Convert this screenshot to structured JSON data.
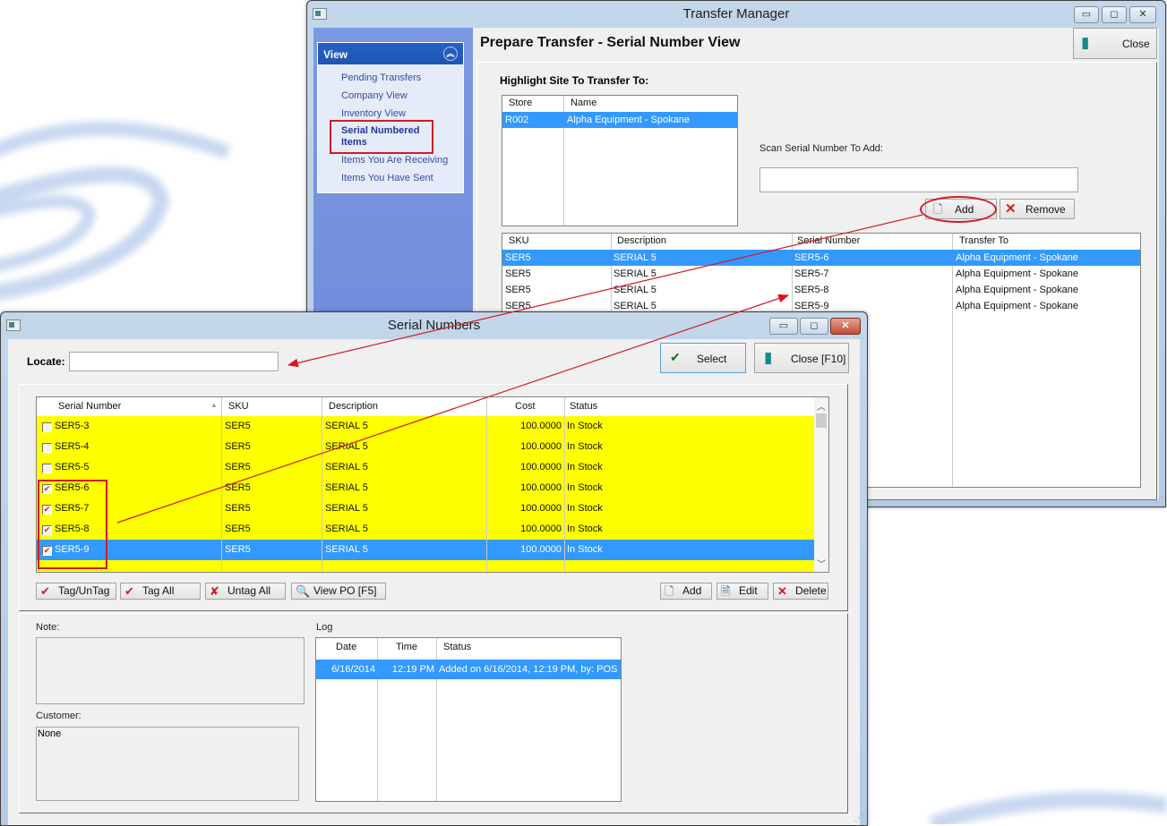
{
  "transfer_manager": {
    "title": "Transfer Manager",
    "page_title": "Prepare Transfer - Serial Number View",
    "close_label": "Close",
    "nav": {
      "header": "View",
      "items": [
        {
          "label": "Pending Transfers"
        },
        {
          "label": "Company View"
        },
        {
          "label": "Inventory View"
        },
        {
          "label": "Serial Numbered Items",
          "active": true
        },
        {
          "label": "Items You Are Receiving"
        },
        {
          "label": "Items You Have Sent"
        }
      ]
    },
    "site_label": "Highlight Site To Transfer To:",
    "sites": {
      "columns": [
        "Store",
        "Name"
      ],
      "rows": [
        [
          "R002",
          "Alpha Equipment - Spokane"
        ]
      ]
    },
    "scan_label": "Scan Serial Number To Add:",
    "scan_value": "",
    "add_label": "Add",
    "remove_label": "Remove",
    "transfers": {
      "columns": [
        "SKU",
        "Description",
        "Serial Number",
        "Transfer To"
      ],
      "rows": [
        [
          "SER5",
          "SERIAL 5",
          "SER5-6",
          "Alpha Equipment - Spokane"
        ],
        [
          "SER5",
          "SERIAL 5",
          "SER5-7",
          "Alpha Equipment - Spokane"
        ],
        [
          "SER5",
          "SERIAL 5",
          "SER5-8",
          "Alpha Equipment - Spokane"
        ],
        [
          "SER5",
          "SERIAL 5",
          "SER5-9",
          "Alpha Equipment - Spokane"
        ]
      ]
    }
  },
  "serial_numbers": {
    "title": "Serial Numbers",
    "locate_label": "Locate:",
    "locate_value": "",
    "select_label": "Select",
    "close_label": "Close [F10]",
    "grid": {
      "columns": [
        "Serial Number",
        "SKU",
        "Description",
        "Cost",
        "Status"
      ],
      "rows": [
        {
          "tagged": false,
          "serial": "SER5-3",
          "sku": "SER5",
          "desc": "SERIAL 5",
          "cost": "100.0000",
          "status": "In Stock"
        },
        {
          "tagged": false,
          "serial": "SER5-4",
          "sku": "SER5",
          "desc": "SERIAL 5",
          "cost": "100.0000",
          "status": "In Stock"
        },
        {
          "tagged": false,
          "serial": "SER5-5",
          "sku": "SER5",
          "desc": "SERIAL 5",
          "cost": "100.0000",
          "status": "In Stock"
        },
        {
          "tagged": true,
          "serial": "SER5-6",
          "sku": "SER5",
          "desc": "SERIAL 5",
          "cost": "100.0000",
          "status": "In Stock"
        },
        {
          "tagged": true,
          "serial": "SER5-7",
          "sku": "SER5",
          "desc": "SERIAL 5",
          "cost": "100.0000",
          "status": "In Stock"
        },
        {
          "tagged": true,
          "serial": "SER5-8",
          "sku": "SER5",
          "desc": "SERIAL 5",
          "cost": "100.0000",
          "status": "In Stock"
        },
        {
          "tagged": true,
          "serial": "SER5-9",
          "sku": "SER5",
          "desc": "SERIAL 5",
          "cost": "100.0000",
          "status": "In Stock",
          "selected": true
        }
      ]
    },
    "buttons": {
      "tag_untag": "Tag/UnTag",
      "tag_all": "Tag All",
      "untag_all": "Untag All",
      "view_po": "View PO [F5]",
      "add": "Add",
      "edit": "Edit",
      "delete": "Delete"
    },
    "note_label": "Note:",
    "note_value": "",
    "customer_label": "Customer:",
    "customer_value": "None",
    "log": {
      "label": "Log",
      "columns": [
        "Date",
        "Time",
        "Status"
      ],
      "rows": [
        [
          "6/16/2014",
          "12:19 PM",
          "Added on  6/16/2014, 12:19 PM, by: POS"
        ]
      ]
    }
  },
  "colors": {
    "tagged_row": "#ffff00",
    "selection": "#3399ff",
    "annotation": "#d11c26",
    "nav_header": "#2463c4"
  }
}
